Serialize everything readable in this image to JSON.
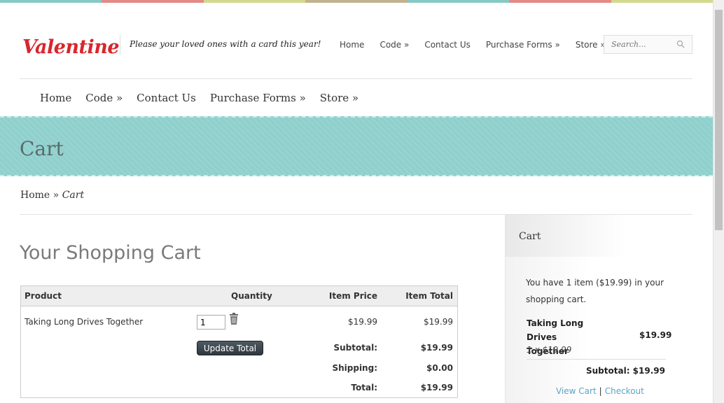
{
  "colors": {
    "stripe": [
      "#85c9c5",
      "#e48a88",
      "#d4d98e",
      "#c2b28f",
      "#85c9c5",
      "#e48a88",
      "#d4d98e"
    ],
    "banner": "#8fd0cd",
    "logo": "#d9262c",
    "link": "#5aa5c4"
  },
  "header": {
    "logo": "Valentine",
    "tagline": "Please your loved ones with a card this year!",
    "search_placeholder": "Search...",
    "topnav": [
      "Home",
      "Code »",
      "Contact Us",
      "Purchase Forms »",
      "Store »"
    ]
  },
  "mainnav": [
    "Home",
    "Code »",
    "Contact Us",
    "Purchase Forms »",
    "Store »"
  ],
  "banner": {
    "title": "Cart"
  },
  "breadcrumb": {
    "home": "Home",
    "sep": "»",
    "current": "Cart"
  },
  "main": {
    "title": "Your Shopping Cart",
    "table": {
      "headers": {
        "product": "Product",
        "quantity": "Quantity",
        "item_price": "Item Price",
        "item_total": "Item Total"
      },
      "row": {
        "product": "Taking Long Drives Together",
        "quantity": "1",
        "item_price": "$19.99",
        "item_total": "$19.99"
      },
      "update_button": "Update Total",
      "subtotal_label": "Subtotal:",
      "subtotal": "$19.99",
      "shipping_label": "Shipping:",
      "shipping": "$0.00",
      "total_label": "Total:",
      "total": "$19.99"
    }
  },
  "sidebar": {
    "title": "Cart",
    "summary": "You have 1 item ($19.99) in your shopping cart.",
    "item_name": "Taking Long Drives Together",
    "item_price": "$19.99",
    "item_qty_line": "1 x $19.99",
    "subtotal": "Subtotal: $19.99",
    "view_cart": "View Cart",
    "separator": "|",
    "checkout": "Checkout"
  }
}
